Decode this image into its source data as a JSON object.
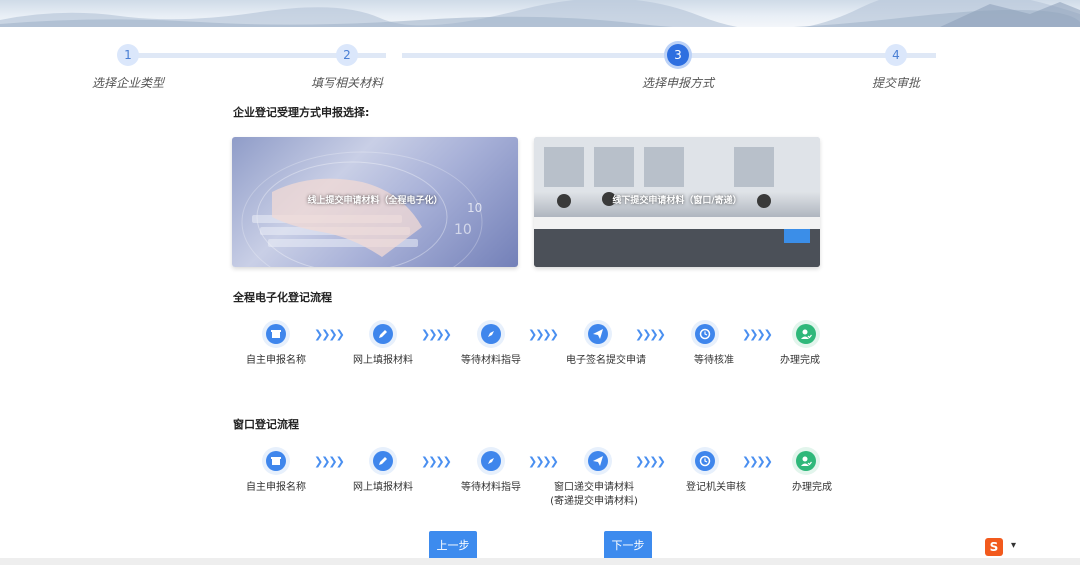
{
  "stepper": {
    "steps": [
      {
        "num": "1",
        "label": "选择企业类型"
      },
      {
        "num": "2",
        "label": "填写相关材料"
      },
      {
        "num": "3",
        "label": "选择申报方式"
      },
      {
        "num": "4",
        "label": "提交审批"
      }
    ],
    "active_step": 3
  },
  "method_section": {
    "title": "企业登记受理方式申报选择:",
    "online_card": "线上提交申请材料（全程电子化）",
    "offline_card": "线下提交申请材料（窗口/寄递）"
  },
  "online_flow": {
    "title": "全程电子化登记流程",
    "steps": [
      "自主申报名称",
      "网上填报材料",
      "等待材料指导",
      "电子签名提交申请",
      "等待核准",
      "办理完成"
    ]
  },
  "window_flow": {
    "title": "窗口登记流程",
    "steps": [
      "自主申报名称",
      "网上填报材料",
      "等待材料指导",
      "窗口递交申请材料",
      "登记机关审核",
      "办理完成"
    ],
    "step4_sub": "(寄递提交申请材料)"
  },
  "buttons": {
    "prev": "上一步",
    "next": "下一步"
  },
  "ime": {
    "logo": "S"
  },
  "colors": {
    "accent": "#3d8bee",
    "active_step": "#2e6fe0",
    "complete_green": "#2fb87a"
  },
  "icons": [
    "building-icon",
    "pencil-icon",
    "compass-icon",
    "send-icon",
    "clock-icon",
    "user-check-icon"
  ]
}
